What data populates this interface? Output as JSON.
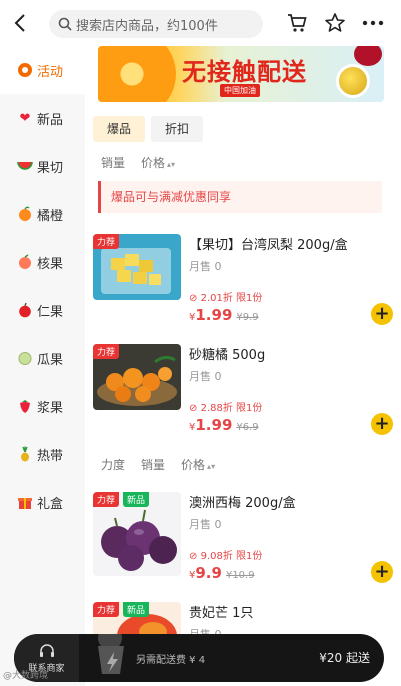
{
  "header": {
    "search_placeholder": "搜索店内商品，约100件"
  },
  "sidebar": {
    "items": [
      {
        "label": "活动",
        "icon": "activity-icon",
        "active": true
      },
      {
        "label": "新品",
        "icon": "heart-icon"
      },
      {
        "label": "果切",
        "icon": "watermelon-icon"
      },
      {
        "label": "橘橙",
        "icon": "orange-icon"
      },
      {
        "label": "核果",
        "icon": "peach-icon"
      },
      {
        "label": "仁果",
        "icon": "apple-icon"
      },
      {
        "label": "瓜果",
        "icon": "melon-icon"
      },
      {
        "label": "浆果",
        "icon": "strawberry-icon"
      },
      {
        "label": "热带",
        "icon": "pineapple-icon"
      },
      {
        "label": "礼盒",
        "icon": "gift-icon"
      }
    ]
  },
  "banner": {
    "title": "无接触配送",
    "tag": "中国加油"
  },
  "tabs": [
    "爆品",
    "折扣"
  ],
  "sort1": {
    "sales": "销量",
    "price": "价格"
  },
  "notice": "爆品可与满减优惠同享",
  "sort2": {
    "strength": "力度",
    "sales": "销量",
    "price": "价格"
  },
  "products": [
    {
      "name": "【果切】台湾凤梨 200g/盒",
      "sold": "月售 0",
      "discount": "2.01折 限1份",
      "symbol": "¥",
      "price": "1.99",
      "original": "¥9.9",
      "badge": "力荐"
    },
    {
      "name": "砂糖橘 500g",
      "sold": "月售 0",
      "discount": "2.88折 限1份",
      "symbol": "¥",
      "price": "1.99",
      "original": "¥6.9",
      "badge": "力荐"
    },
    {
      "name": "澳洲西梅 200g/盒",
      "sold": "月售 0",
      "discount": "9.08折 限1份",
      "symbol": "¥",
      "price": "9.9",
      "original": "¥10.9",
      "badge": "力荐",
      "badge2": "新品"
    },
    {
      "name": "贵妃芒 1只",
      "sold": "月售 0",
      "badge": "力荐",
      "badge2": "新品"
    }
  ],
  "bottom": {
    "contact_label": "联系商家",
    "delivery": "另需配送费 ¥ 4",
    "min_order": "¥20 起送"
  },
  "watermark": "@大数跨境",
  "colors": {
    "accent": "#f56a00",
    "price": "#e64545",
    "add_button": "#f5c200"
  }
}
